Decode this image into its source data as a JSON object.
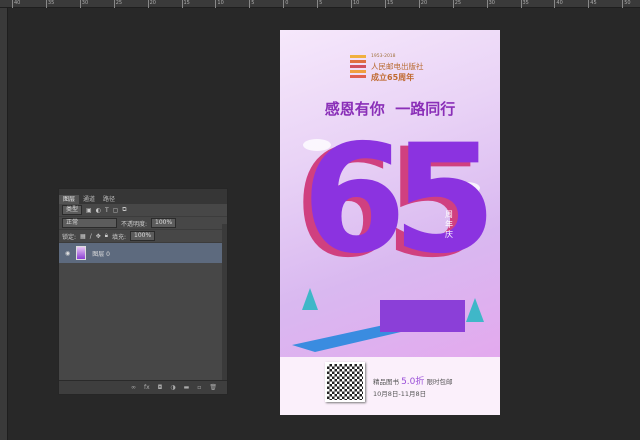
{
  "ruler": {
    "ticks": [
      "40",
      "35",
      "30",
      "25",
      "20",
      "15",
      "10",
      "5",
      "0",
      "5",
      "10",
      "15",
      "20",
      "25",
      "30",
      "35",
      "40",
      "45",
      "50"
    ]
  },
  "layers_panel": {
    "tabs": [
      "图层",
      "通道",
      "路径"
    ],
    "filter": "类型",
    "blend_mode": "正常",
    "opacity_label": "不透明度:",
    "opacity_value": "100%",
    "lock_label": "锁定:",
    "fill_label": "填充:",
    "fill_value": "100%",
    "layers": [
      {
        "name": "图层 0",
        "visible": true
      }
    ],
    "footer_icons": [
      "link-icon",
      "fx-icon",
      "mask-icon",
      "adjustment-icon",
      "folder-icon",
      "new-layer-icon",
      "trash-icon"
    ],
    "fx_label": "fx"
  },
  "poster": {
    "years": "1953-2018",
    "publisher": "人民邮电出版社",
    "anniversary": "成立65周年",
    "slogan": "感恩有你  一路同行",
    "big_number": "65",
    "side_text": "周年庆",
    "promo_prefix": "精品图书",
    "promo_discount": "5.0折",
    "promo_suffix": "限时包邮",
    "dates": "10月8日-11月8日",
    "accent": "#8a2fd0"
  }
}
